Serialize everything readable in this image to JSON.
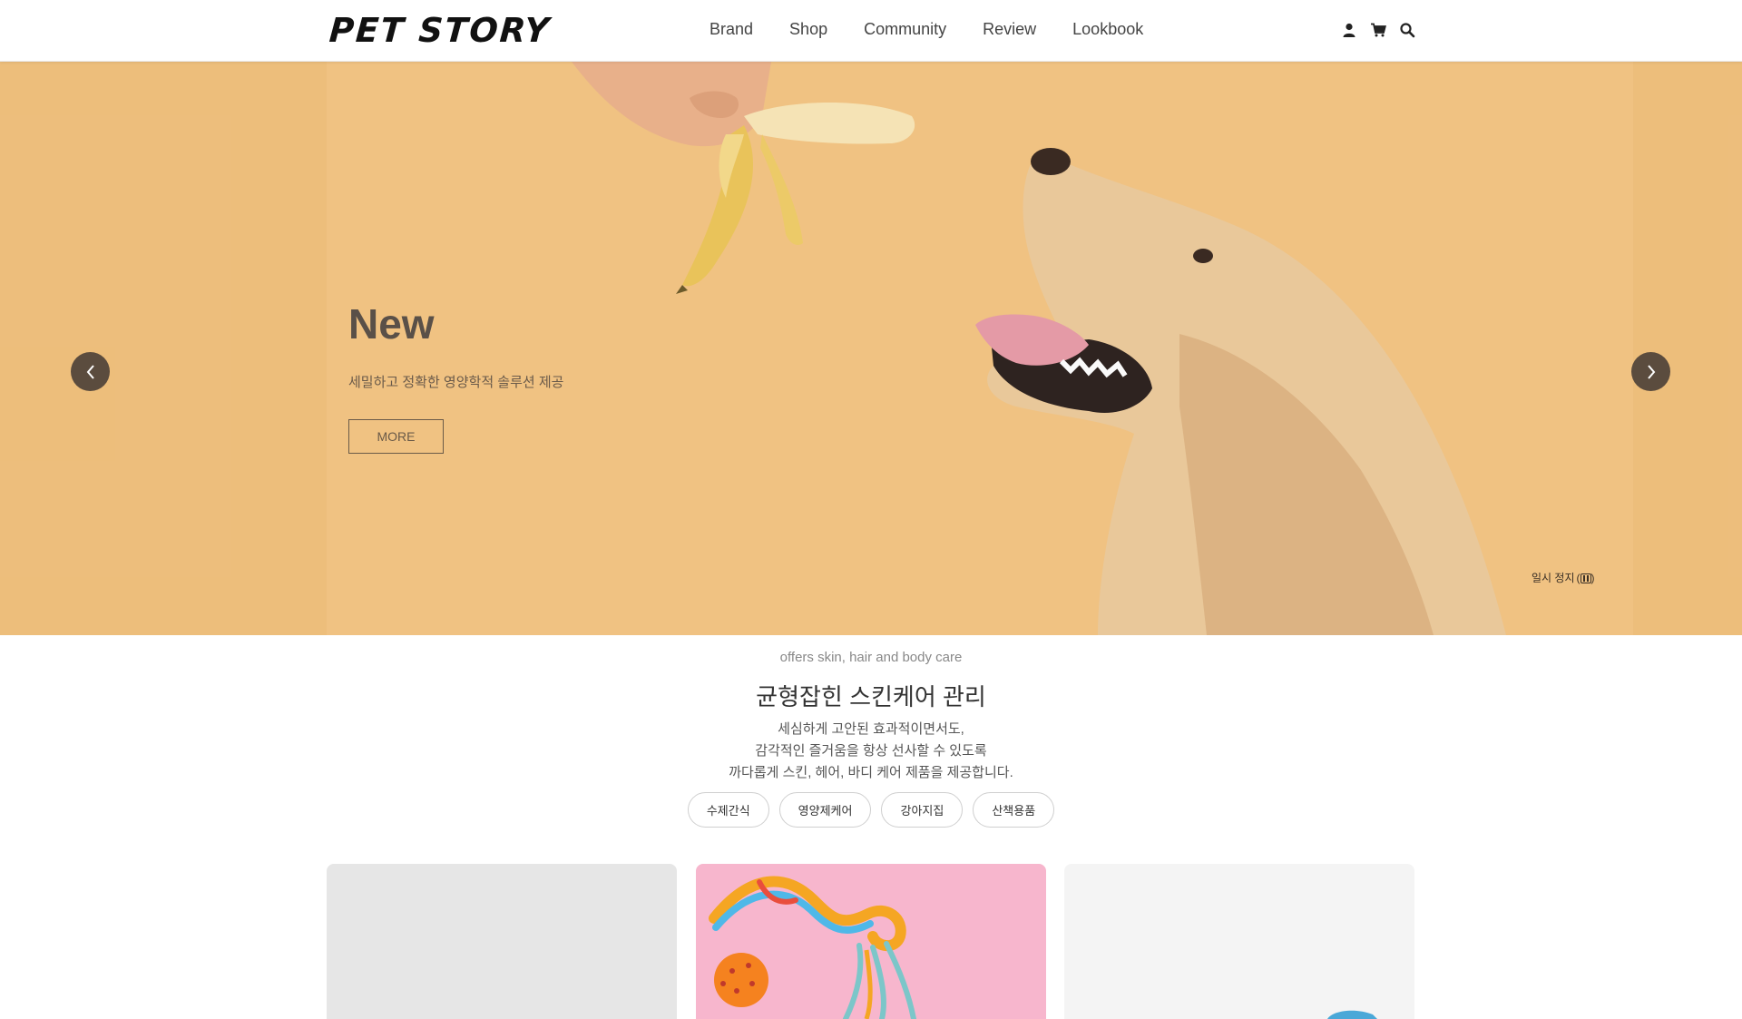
{
  "header": {
    "logo": "PET STORY",
    "nav": [
      "Brand",
      "Shop",
      "Community",
      "Review",
      "Lookbook"
    ],
    "icons": [
      "user-icon",
      "cart-icon",
      "search-icon"
    ]
  },
  "hero": {
    "title": "New",
    "subtitle": "세밀하고 정확한 영양학적 솔루션 제공",
    "more_label": "MORE",
    "pause_label": "일시 정지",
    "background_color": "#f0c282"
  },
  "intro": {
    "eyebrow": "offers skin, hair and body care",
    "title": "균형잡힌 스킨케어 관리",
    "desc_lines": [
      "세심하게 고안된 효과적이면서도,",
      "감각적인 즐거움을 항상 선사할 수 있도록",
      "까다롭게 스킨, 헤어, 바디 케어 제품을 제공합니다."
    ],
    "chips": [
      "수제간식",
      "영양제케어",
      "강아지집",
      "산책용품"
    ]
  },
  "colors": {
    "accent": "#5b4c3e",
    "card_pink": "#f7b6cd"
  }
}
